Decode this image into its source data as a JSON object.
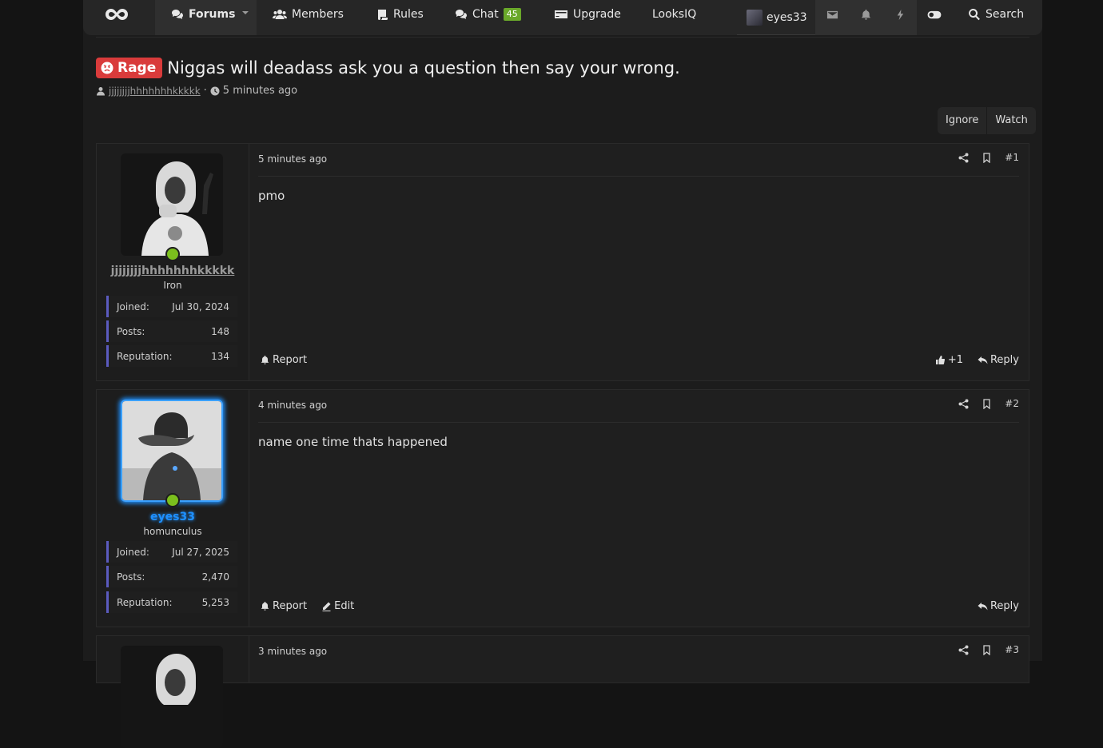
{
  "nav": {
    "forums": "Forums",
    "members": "Members",
    "rules": "Rules",
    "chat": "Chat",
    "chat_count": "45",
    "upgrade": "Upgrade",
    "looksiq": "LooksIQ",
    "username": "eyes33",
    "search": "Search"
  },
  "thread": {
    "prefix": "Rage",
    "title": "Niggas will deadass ask you a question then say your wrong.",
    "author": "jjjjjjjjhhhhhhhkkkkk",
    "time": "5 minutes ago",
    "ignore": "Ignore",
    "watch": "Watch"
  },
  "labels": {
    "joined": "Joined:",
    "posts": "Posts:",
    "reputation": "Reputation:",
    "report": "Report",
    "edit": "Edit",
    "reply": "Reply"
  },
  "posts": [
    {
      "username": "jjjjjjjjhhhhhhhkkkkk",
      "rank": "Iron",
      "joined": "Jul 30, 2024",
      "posts": "148",
      "reputation": "134",
      "time": "5 minutes ago",
      "number": "#1",
      "body": "pmo",
      "likes": "+1"
    },
    {
      "username": "eyes33",
      "rank": "homunculus",
      "joined": "Jul 27, 2025",
      "posts": "2,470",
      "reputation": "5,253",
      "time": "4 minutes ago",
      "number": "#2",
      "body": "name one time thats happened"
    },
    {
      "time": "3 minutes ago",
      "number": "#3"
    }
  ]
}
